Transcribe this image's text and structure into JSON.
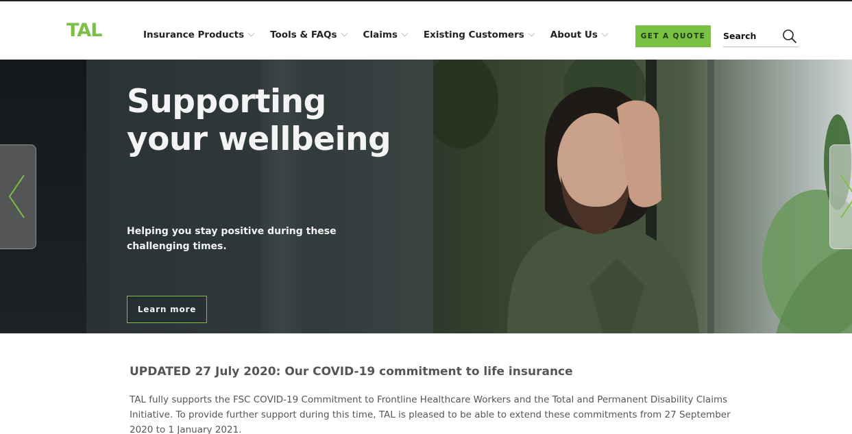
{
  "header": {
    "logo": "TAL",
    "nav": [
      {
        "label": "Insurance Products"
      },
      {
        "label": "Tools & FAQs"
      },
      {
        "label": "Claims"
      },
      {
        "label": "Existing Customers"
      },
      {
        "label": "About Us"
      }
    ],
    "quote_label": "GET A QUOTE",
    "search_label": "Search"
  },
  "hero": {
    "title": "Supporting your wellbeing",
    "subtitle": "Helping you stay positive during these challenging times.",
    "button_label": "Learn more"
  },
  "content": {
    "heading": "UPDATED 27 July 2020: Our COVID-19 commitment to life insurance",
    "body": "TAL fully supports the FSC COVID-19 Commitment to Frontline Healthcare Workers and the Total and Permanent Disability Claims Initiative. To provide further support during this time, TAL is pleased to be able to extend these commitments from 27 September 2020 to 1 January 2021."
  },
  "colors": {
    "brand_green": "#7ac143",
    "dark_text": "#222222",
    "body_text": "#555555"
  },
  "icons": {
    "search": "search-icon",
    "chevron": "chevron-down-icon",
    "prev": "chevron-left-icon",
    "next": "chevron-right-icon"
  }
}
